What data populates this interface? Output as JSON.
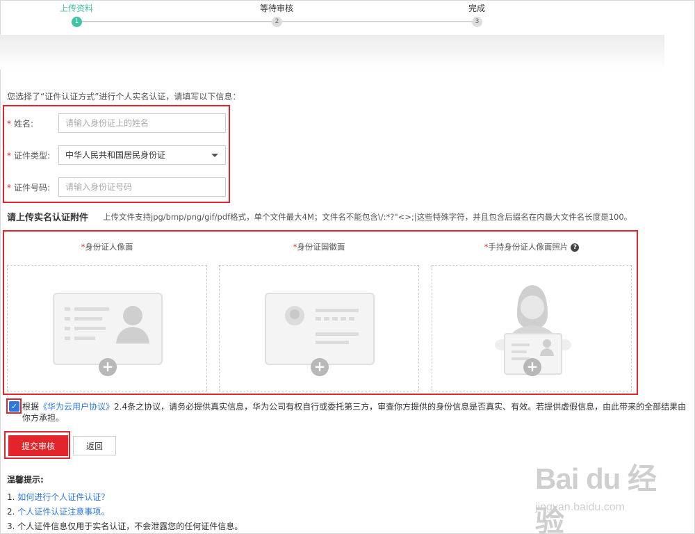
{
  "steps": [
    {
      "label": "上传资料",
      "num": "1",
      "active": true
    },
    {
      "label": "等待审核",
      "num": "2",
      "active": false
    },
    {
      "label": "完成",
      "num": "3",
      "active": false
    }
  ],
  "intro": "您选择了“证件认证方式”进行个人实名认证，请填写以下信息：",
  "form": {
    "required_mark": "*",
    "name_label": "姓名:",
    "name_placeholder": "请输入身份证上的姓名",
    "idtype_label": "证件类型:",
    "idtype_value": "中华人民共和国居民身份证",
    "idnum_label": "证件号码:",
    "idnum_placeholder": "请输入身份证号码"
  },
  "upload": {
    "heading": "请上传实名认证附件",
    "hint": "上传文件支持jpg/bmp/png/gif/pdf格式，单个文件最大4M；文件名不能包含\\/:*?\"<>;|这些特殊字符，并且包含后缀名在内最大文件名长度是100。",
    "cards": [
      {
        "title": "身份证人像面"
      },
      {
        "title": "身份证国徽面"
      },
      {
        "title": "手持身份证人像面照片"
      }
    ],
    "help_icon": "?",
    "plus": "+"
  },
  "agreement": {
    "checked": true,
    "prefix": "根据",
    "link": "《华为云用户协议》",
    "suffix": "2.4条之协议，请务必提供真实信息，华为公司有权自行或委托第三方，审查你方提供的身份信息是否真实、有效。若提供虚假信息，由此带来的全部结果由你方承担。"
  },
  "buttons": {
    "submit": "提交审核",
    "back": "返回"
  },
  "tips": {
    "title": "温馨提示:",
    "items": [
      {
        "num": "1.",
        "text": "如何进行个人证件认证？",
        "link": true
      },
      {
        "num": "2.",
        "text": "个人证件认证注意事项。",
        "link": true
      },
      {
        "num": "3.",
        "text": "个人证件信息仅用于实名认证，不会泄露您的任何证件信息。",
        "link": false
      }
    ]
  },
  "watermark": {
    "main": "Bai du 经验",
    "sub": "jingyan.baidu.com"
  },
  "colors": {
    "accent_green": "#3fc3a5",
    "primary_red": "#e3242b",
    "link_blue": "#2c77e0"
  }
}
